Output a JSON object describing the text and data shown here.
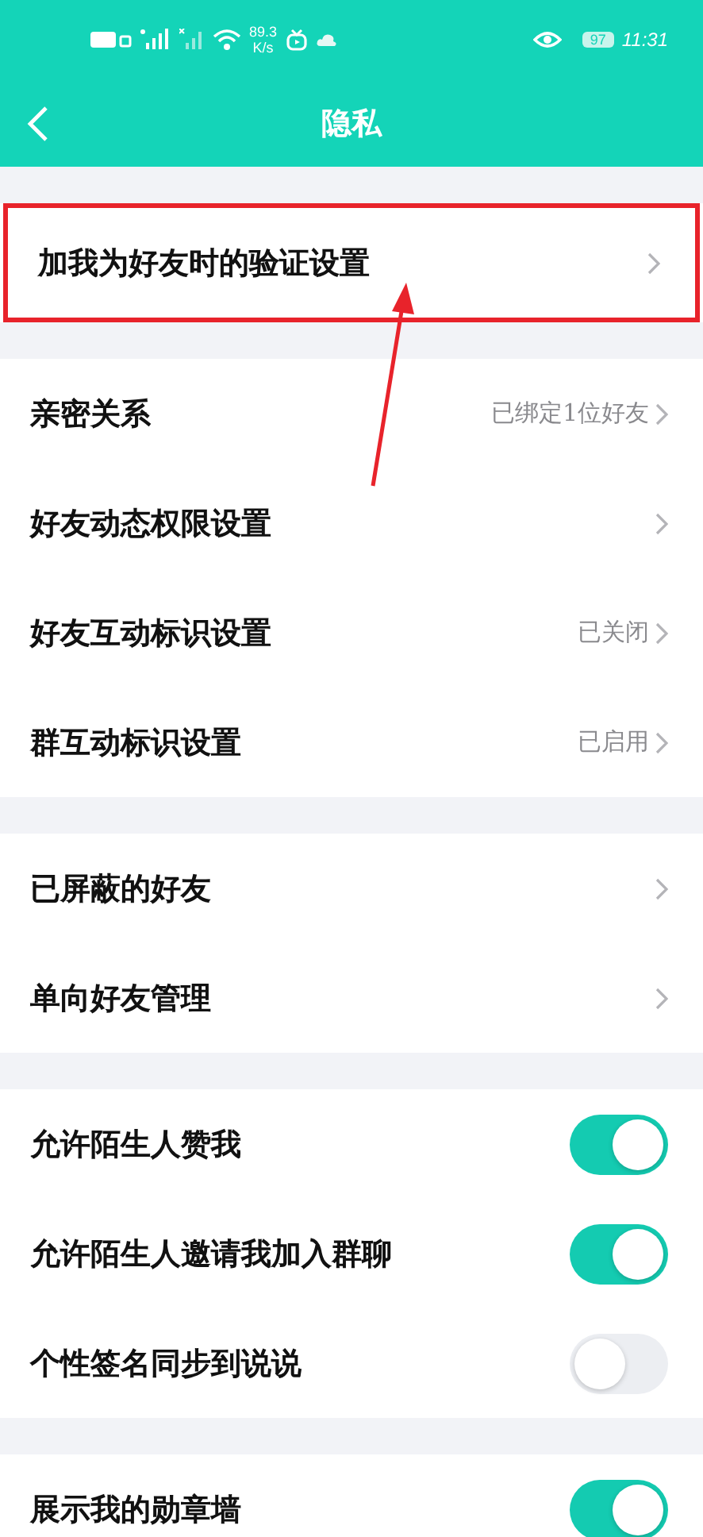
{
  "status_bar": {
    "speed": "89.3",
    "speed_unit": "K/s",
    "battery": "97",
    "time": "11:31"
  },
  "header": {
    "title": "隐私"
  },
  "sections": [
    {
      "items": [
        {
          "kind": "link",
          "label": "加我为好友时的验证设置",
          "highlighted": true
        }
      ]
    },
    {
      "items": [
        {
          "kind": "link",
          "label": "亲密关系",
          "value": "已绑定1位好友"
        },
        {
          "kind": "link",
          "label": "好友动态权限设置"
        },
        {
          "kind": "link",
          "label": "好友互动标识设置",
          "value": "已关闭"
        },
        {
          "kind": "link",
          "label": "群互动标识设置",
          "value": "已启用"
        }
      ]
    },
    {
      "items": [
        {
          "kind": "link",
          "label": "已屏蔽的好友"
        },
        {
          "kind": "link",
          "label": "单向好友管理"
        }
      ]
    },
    {
      "items": [
        {
          "kind": "toggle",
          "label": "允许陌生人赞我",
          "on": true
        },
        {
          "kind": "toggle",
          "label": "允许陌生人邀请我加入群聊",
          "on": true
        },
        {
          "kind": "toggle",
          "label": "个性签名同步到说说",
          "on": false
        }
      ]
    },
    {
      "items": [
        {
          "kind": "toggle",
          "label": "展示我的勋章墙",
          "on": true
        }
      ]
    }
  ]
}
